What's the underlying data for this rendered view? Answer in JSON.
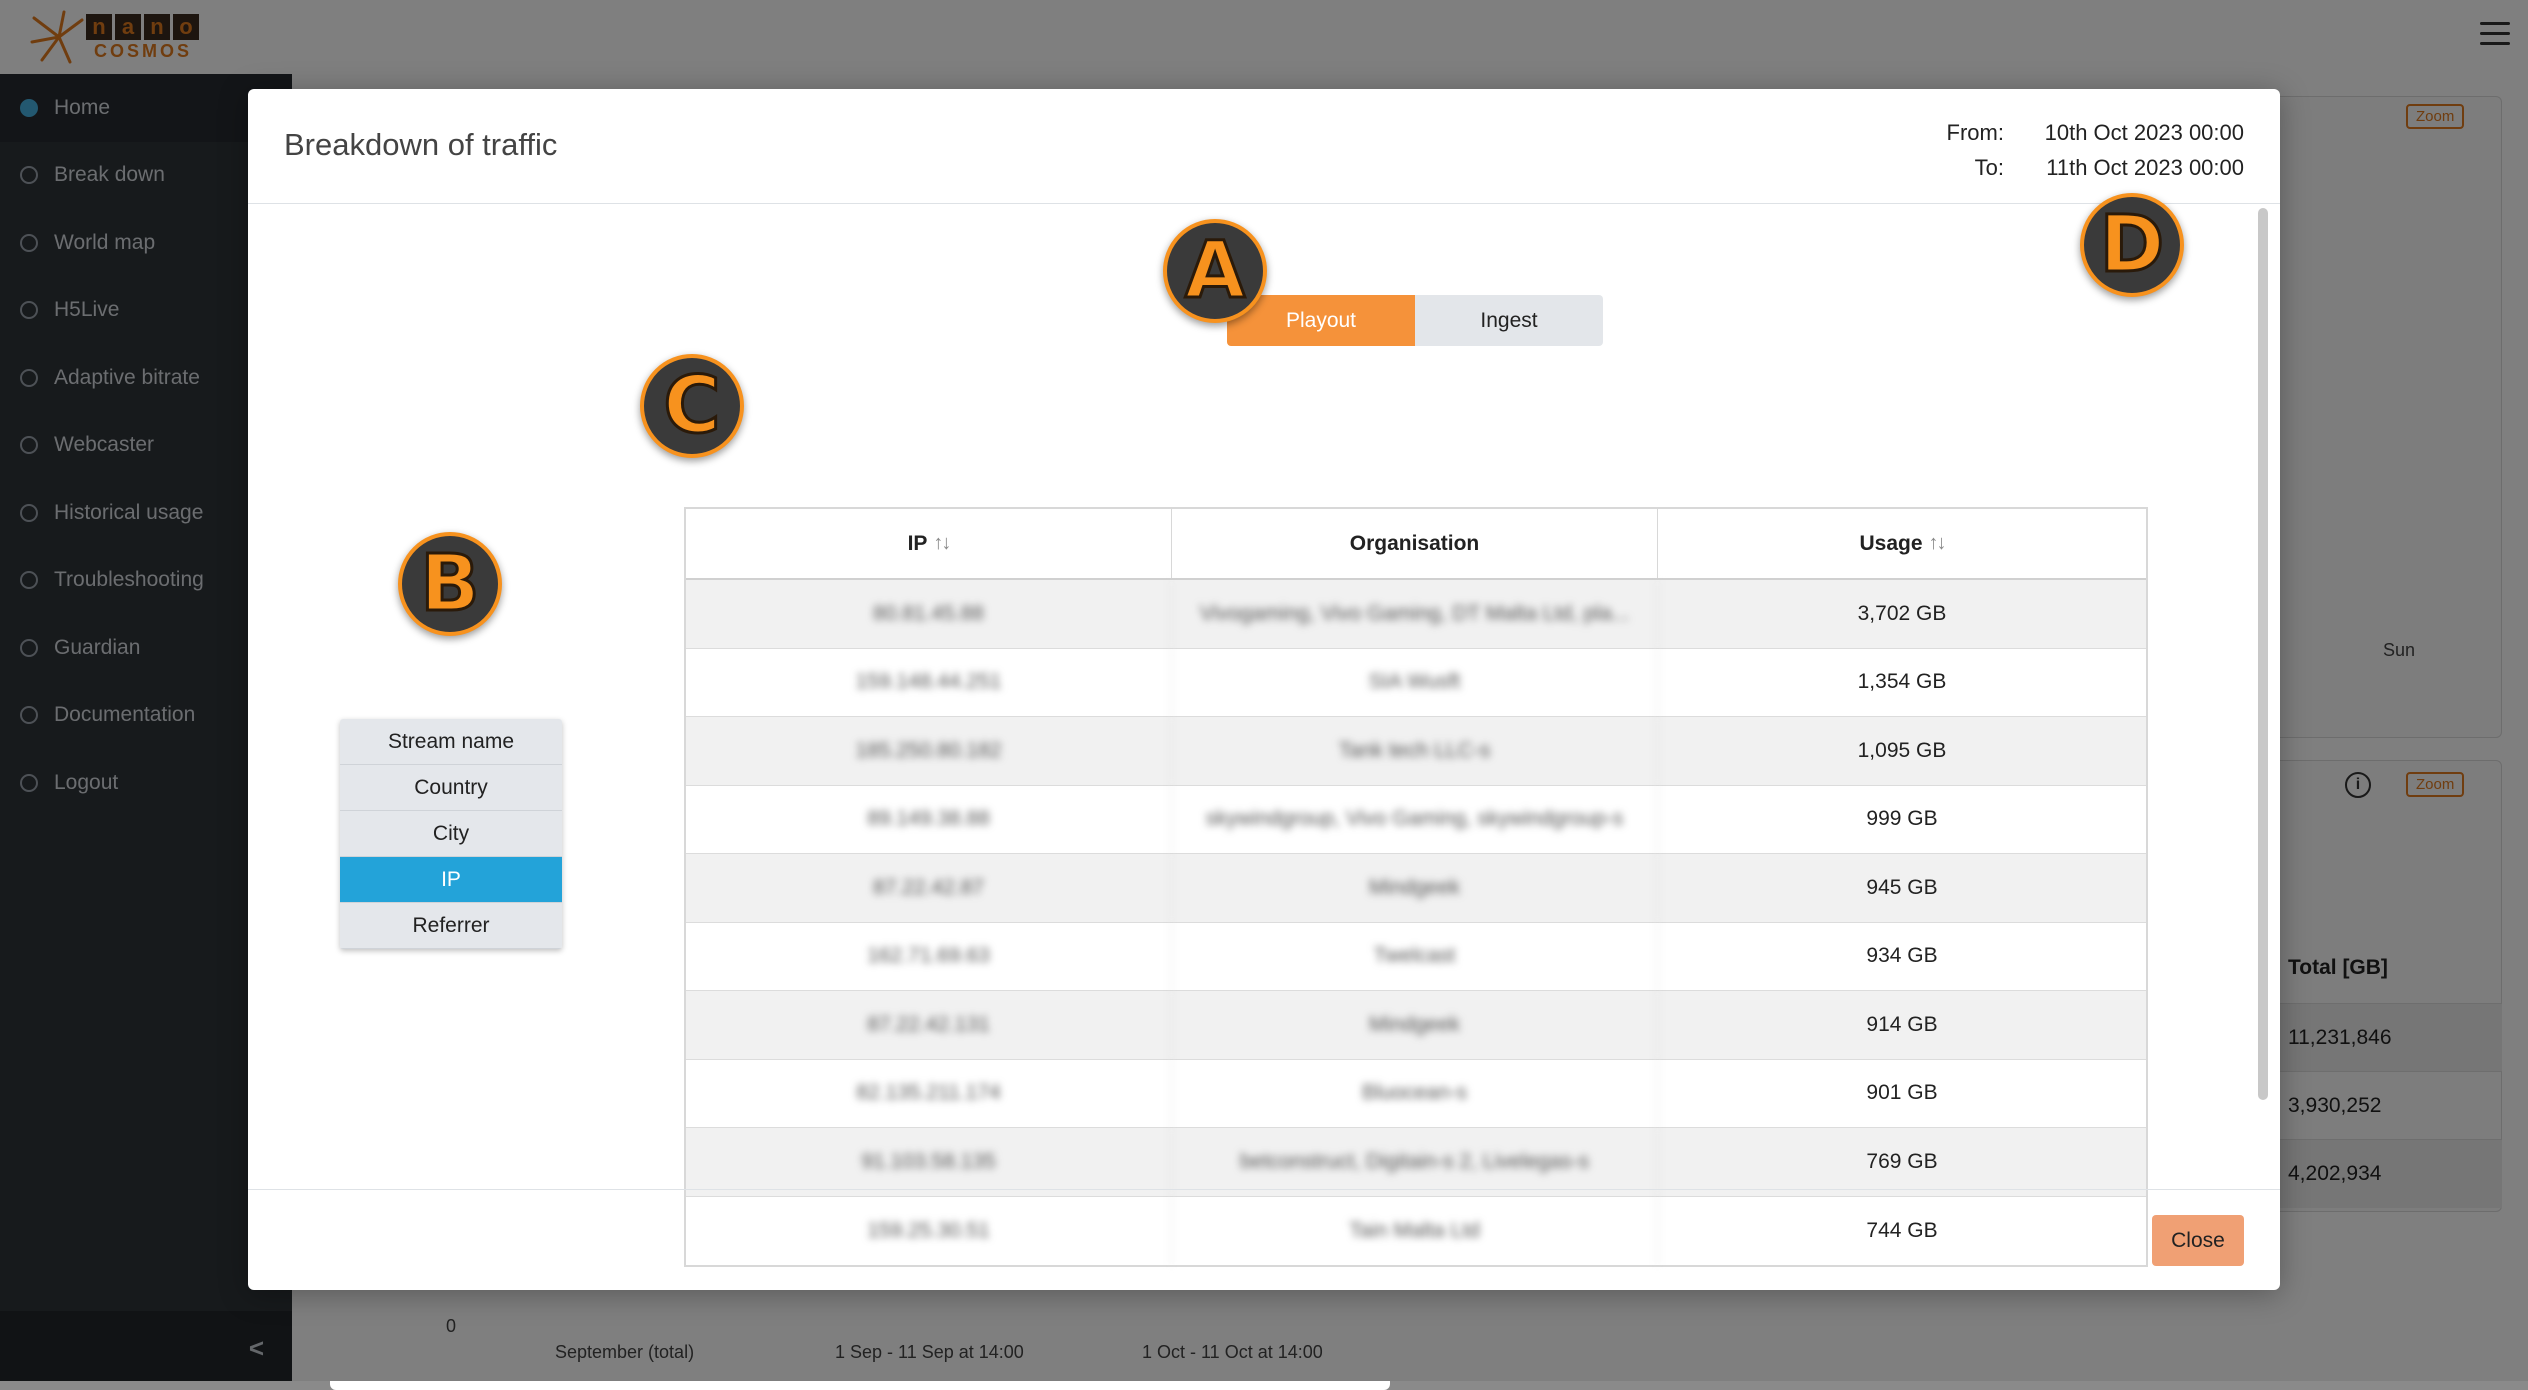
{
  "app": {
    "logo_letters": [
      "n",
      "a",
      "n",
      "o"
    ],
    "logo_sub": "COSMOS"
  },
  "sidebar": {
    "items": [
      {
        "label": "Home",
        "icon": "home-icon"
      },
      {
        "label": "Break down",
        "icon": "pie-icon"
      },
      {
        "label": "World map",
        "icon": "globe-icon"
      },
      {
        "label": "H5Live",
        "icon": "play-icon"
      },
      {
        "label": "Adaptive bitrate",
        "icon": "bitrate-icon"
      },
      {
        "label": "Webcaster",
        "icon": "camera-icon"
      },
      {
        "label": "Historical usage",
        "icon": "clock-icon"
      },
      {
        "label": "Troubleshooting",
        "icon": "wrench-icon"
      },
      {
        "label": "Guardian",
        "icon": "tools-icon"
      },
      {
        "label": "Documentation",
        "icon": "book-icon"
      },
      {
        "label": "Logout",
        "icon": "logout-icon"
      }
    ],
    "collapse_glyph": "<"
  },
  "background": {
    "zoom_label": "Zoom",
    "day_label": "Sun",
    "info_glyph": "i",
    "total_header": "Total [GB]",
    "totals": [
      "11,231,846",
      "3,930,252",
      "4,202,934"
    ],
    "bottom_axis_zero": "0",
    "bottom_categories": [
      "September (total)",
      "1 Sep - 11 Sep at 14:00",
      "1 Oct - 11 Oct at 14:00"
    ]
  },
  "modal": {
    "title": "Breakdown of traffic",
    "from_label": "From:",
    "from_value": "10th Oct 2023 00:00",
    "to_label": "To:",
    "to_value": "11th Oct 2023 00:00",
    "toggle": {
      "playout": "Playout",
      "ingest": "Ingest",
      "selected": "Playout"
    },
    "categories": [
      "Stream name",
      "Country",
      "City",
      "IP",
      "Referrer"
    ],
    "selected_category": "IP",
    "table": {
      "headers": [
        "IP",
        "Organisation",
        "Usage"
      ],
      "sort_glyph": "↑↓",
      "rows": [
        {
          "ip": "80.81.45.88",
          "org": "Vivogaming, Vivo Gaming, DT Malta Ltd, pla...",
          "usage": "3,702 GB"
        },
        {
          "ip": "159.148.44.251",
          "org": "SIA Wusft",
          "usage": "1,354 GB"
        },
        {
          "ip": "185.250.80.182",
          "org": "Tank tech LLC-s",
          "usage": "1,095 GB"
        },
        {
          "ip": "89.149.38.88",
          "org": "skywindgroup, Vivo Gaming, skywindgroup-s",
          "usage": "999 GB"
        },
        {
          "ip": "87.22.42.87",
          "org": "Mindgeek",
          "usage": "945 GB"
        },
        {
          "ip": "162.71.69.63",
          "org": "Twelcast",
          "usage": "934 GB"
        },
        {
          "ip": "87.22.42.131",
          "org": "Mindgeek",
          "usage": "914 GB"
        },
        {
          "ip": "82.135.211.174",
          "org": "Bluocean-s",
          "usage": "901 GB"
        },
        {
          "ip": "91.103.58.135",
          "org": "betconstruct, Digitain-s 2, Livelegas-s",
          "usage": "769 GB"
        },
        {
          "ip": "159.25.30.51",
          "org": "Tain Malta Ltd",
          "usage": "744 GB"
        }
      ]
    },
    "close_label": "Close"
  },
  "annotations": {
    "a": "A",
    "b": "B",
    "c": "C",
    "d": "D"
  }
}
